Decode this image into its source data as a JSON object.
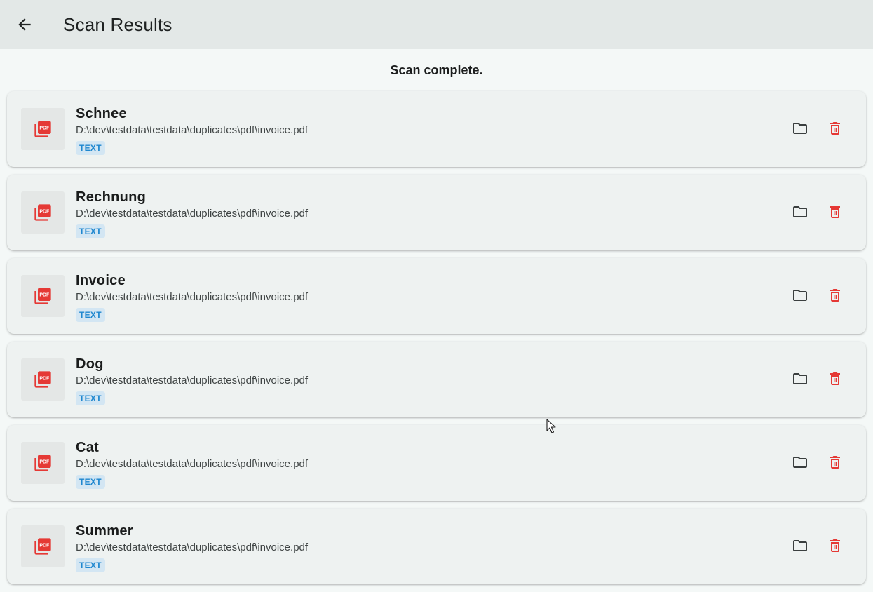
{
  "header": {
    "title": "Scan Results",
    "back_icon": "arrow-back-icon"
  },
  "status": {
    "text": "Scan complete."
  },
  "results": [
    {
      "name": "Schnee",
      "path": "D:\\dev\\testdata\\testdata\\duplicates\\pdf\\invoice.pdf",
      "badge": "TEXT",
      "thumb_label": "PDF"
    },
    {
      "name": "Rechnung",
      "path": "D:\\dev\\testdata\\testdata\\duplicates\\pdf\\invoice.pdf",
      "badge": "TEXT",
      "thumb_label": "PDF"
    },
    {
      "name": "Invoice",
      "path": "D:\\dev\\testdata\\testdata\\duplicates\\pdf\\invoice.pdf",
      "badge": "TEXT",
      "thumb_label": "PDF"
    },
    {
      "name": "Dog",
      "path": "D:\\dev\\testdata\\testdata\\duplicates\\pdf\\invoice.pdf",
      "badge": "TEXT",
      "thumb_label": "PDF"
    },
    {
      "name": "Cat",
      "path": "D:\\dev\\testdata\\testdata\\duplicates\\pdf\\invoice.pdf",
      "badge": "TEXT",
      "thumb_label": "PDF"
    },
    {
      "name": "Summer",
      "path": "D:\\dev\\testdata\\testdata\\duplicates\\pdf\\invoice.pdf",
      "badge": "TEXT",
      "thumb_label": "PDF"
    }
  ],
  "icons": {
    "thumb": "pdf-file-icon",
    "open_folder": "folder-icon",
    "delete": "trash-icon"
  },
  "colors": {
    "appbar": "#e3e8e7",
    "background": "#f4f8f7",
    "card": "#eef2f1",
    "pdf_red": "#e53935",
    "delete_red": "#e53935",
    "badge_bg": "#d3e6f3",
    "badge_text": "#1f87cf"
  }
}
